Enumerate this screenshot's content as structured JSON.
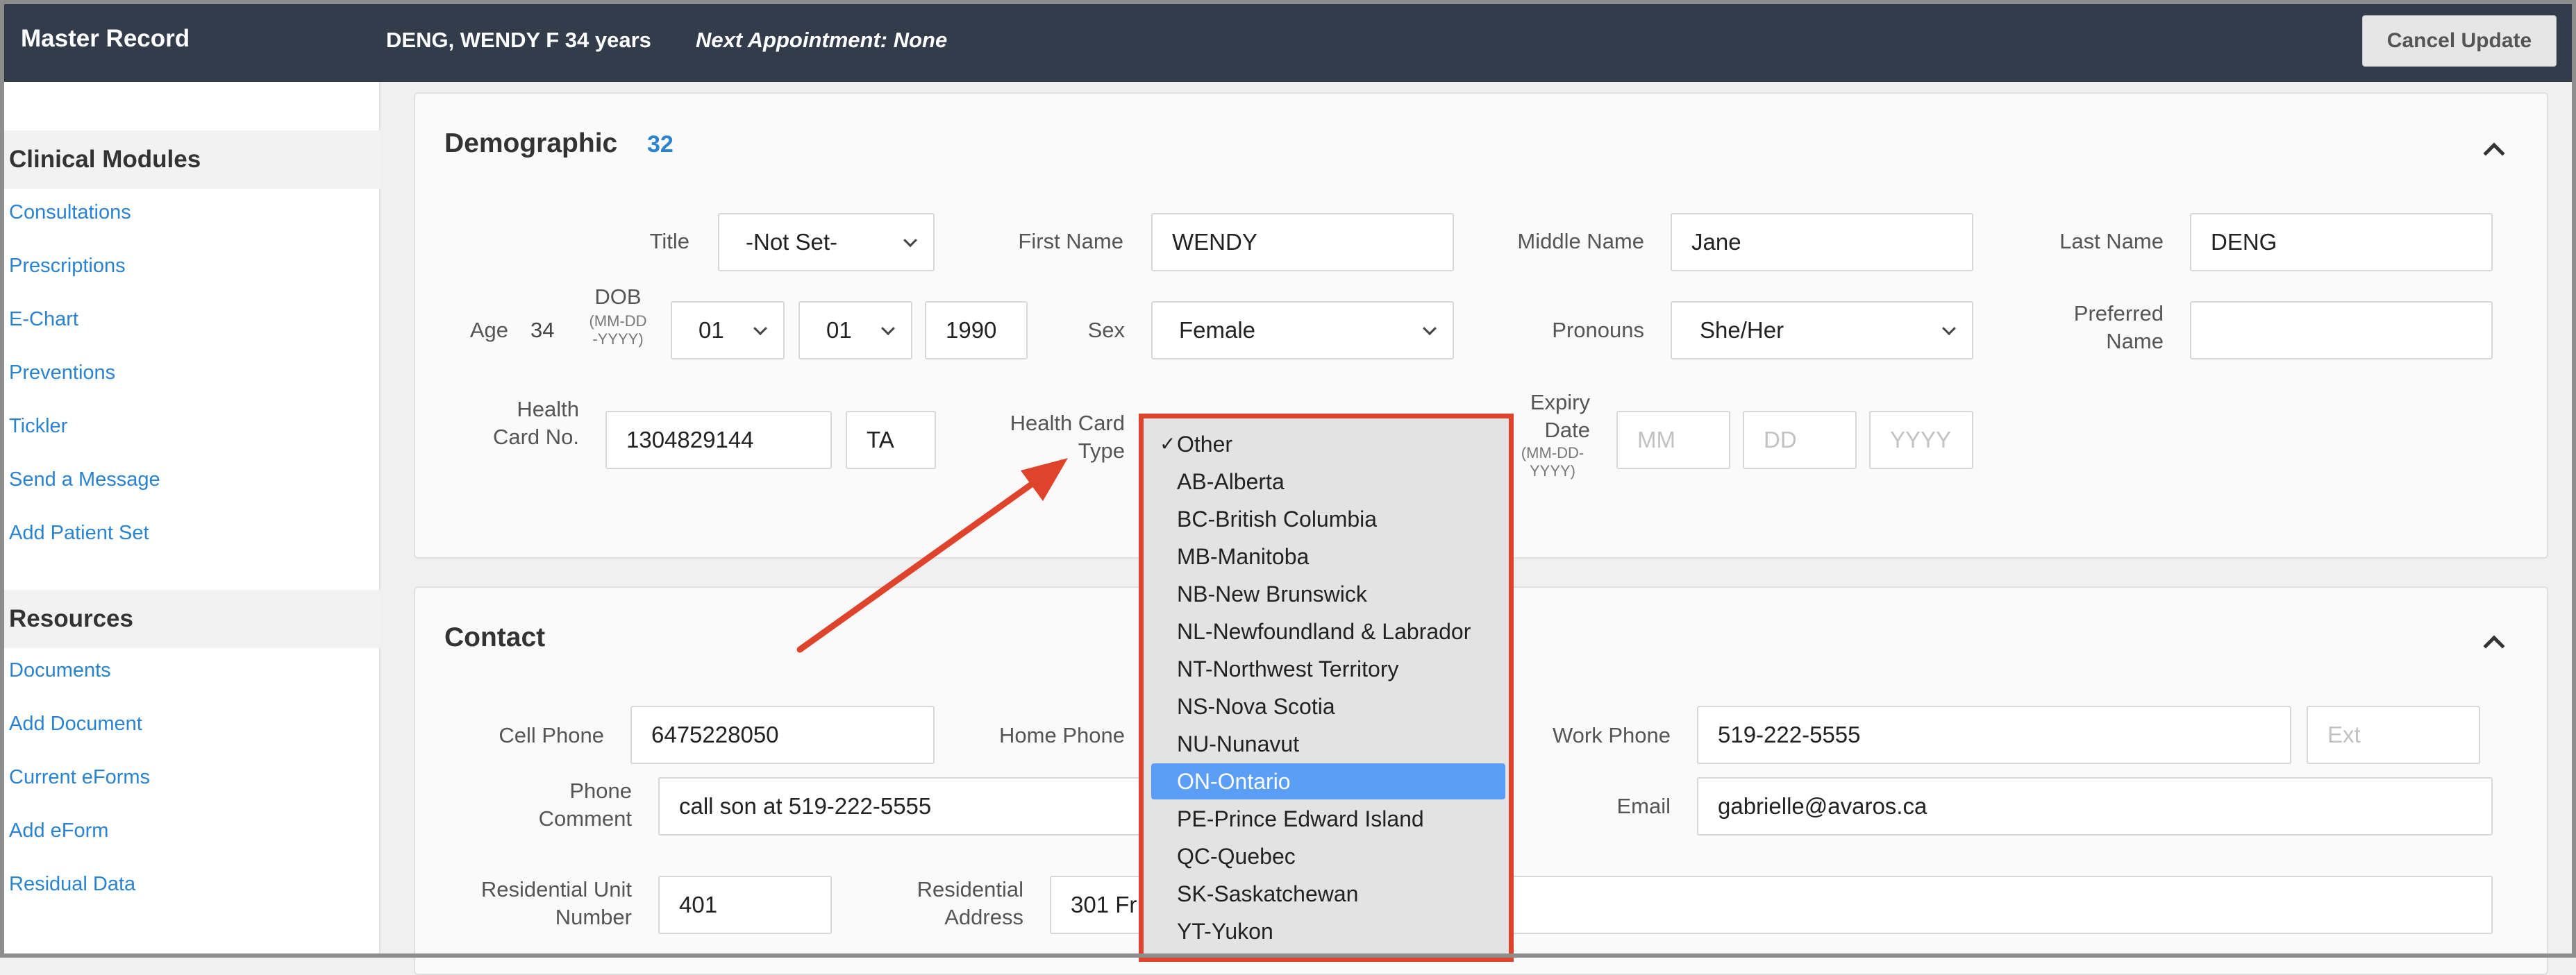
{
  "header": {
    "title": "Master Record",
    "patient": "DENG, WENDY F 34 years",
    "appointment": "Next Appointment: None",
    "cancel_label": "Cancel Update"
  },
  "sidebar": {
    "clinical_heading": "Clinical Modules",
    "clinical_items": [
      "Consultations",
      "Prescriptions",
      "E-Chart",
      "Preventions",
      "Tickler",
      "Send a Message",
      "Add Patient Set"
    ],
    "resources_heading": "Resources",
    "resources_items": [
      "Documents",
      "Add Document",
      "Current eForms",
      "Add eForm",
      "Residual Data"
    ]
  },
  "demographic": {
    "title": "Demographic",
    "count": "32",
    "title_label": "Title",
    "title_value": "-Not Set-",
    "first_name_label": "First Name",
    "first_name": "WENDY",
    "middle_name_label": "Middle Name",
    "middle_name": "Jane",
    "last_name_label": "Last Name",
    "last_name": "DENG",
    "age_label": "Age",
    "age": "34",
    "dob_label": "DOB",
    "dob_format": "(MM-DD-YYYY)",
    "dob_month": "01",
    "dob_day": "01",
    "dob_year": "1990",
    "sex_label": "Sex",
    "sex": "Female",
    "pronouns_label": "Pronouns",
    "pronouns": "She/Her",
    "preferred_name_label": "Preferred Name",
    "health_card_label": "Health Card No.",
    "health_card_no": "1304829144",
    "health_card_version": "TA",
    "health_card_type_label": "Health Card Type",
    "expiry_label": "Expiry Date",
    "expiry_format": "(MM-DD-YYYY)",
    "expiry_mm_placeholder": "MM",
    "expiry_dd_placeholder": "DD",
    "expiry_yyyy_placeholder": "YYYY"
  },
  "health_card_type_dropdown": {
    "selected": "Other",
    "highlighted": "ON-Ontario",
    "options": [
      "Other",
      "AB-Alberta",
      "BC-British Columbia",
      "MB-Manitoba",
      "NB-New Brunswick",
      "NL-Newfoundland & Labrador",
      "NT-Northwest Territory",
      "NS-Nova Scotia",
      "NU-Nunavut",
      "ON-Ontario",
      "PE-Prince Edward Island",
      "QC-Quebec",
      "SK-Saskatchewan",
      "YT-Yukon"
    ]
  },
  "contact": {
    "title": "Contact",
    "cell_phone_label": "Cell Phone",
    "cell_phone": "6475228050",
    "home_phone_label": "Home Phone",
    "work_phone_label": "Work Phone",
    "work_phone": "519-222-5555",
    "ext_placeholder": "Ext",
    "phone_comment_label": "Phone Comment",
    "phone_comment": "call son at 519-222-5555",
    "email_label": "Email",
    "email": "gabrielle@avaros.ca",
    "unit_label": "Residential Unit Number",
    "unit": "401",
    "address_label": "Residential Address",
    "address": "301 Fr"
  },
  "colors": {
    "header_bg": "#333c4b",
    "link": "#2a83d1",
    "annotation_red": "#e0432b",
    "highlight": "#5b9ef8"
  }
}
